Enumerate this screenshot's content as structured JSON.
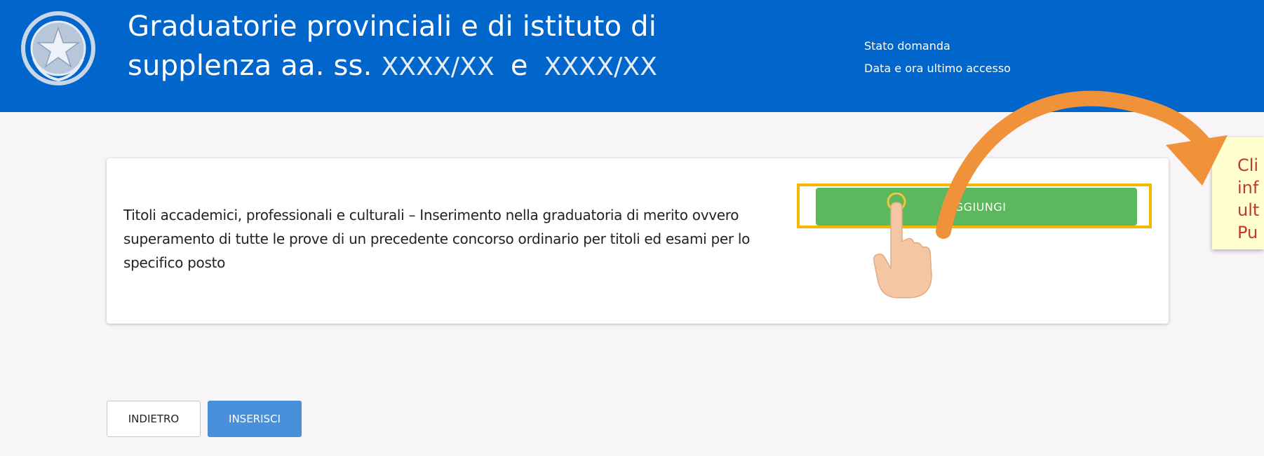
{
  "header": {
    "title_line1": "Graduatorie provinciali e di istituto di",
    "title_line2_prefix": "supplenza aa. ss.",
    "year1": "XXXX/XX",
    "connector": "e",
    "year2": "XXXX/XX",
    "status_label": "Stato domanda",
    "access_label": "Data e ora ultimo accesso"
  },
  "card": {
    "description": "Titoli accademici, professionali e culturali – Inserimento nella graduatoria di merito ovvero superamento di tutte le prove di un precedente concorso ordinario per titoli ed esami per lo specifico posto",
    "add_button": "AGGIUNGI"
  },
  "footer": {
    "back_button": "INDIETRO",
    "insert_button": "INSERISCI"
  },
  "callout": {
    "lines": [
      "Cli",
      "inf",
      "ult",
      "Pu"
    ]
  },
  "colors": {
    "header_bg": "#0066cc",
    "add_button": "#5cb85c",
    "insert_button": "#4a8fd9",
    "highlight_border": "#f4b800",
    "arrow": "#f0923a",
    "callout_text": "#c0392b",
    "callout_bg": "#ffffd0"
  },
  "icons": {
    "emblem": "italian-republic-emblem",
    "arrow": "curved-arrow-icon",
    "hand": "pointing-hand-icon"
  }
}
